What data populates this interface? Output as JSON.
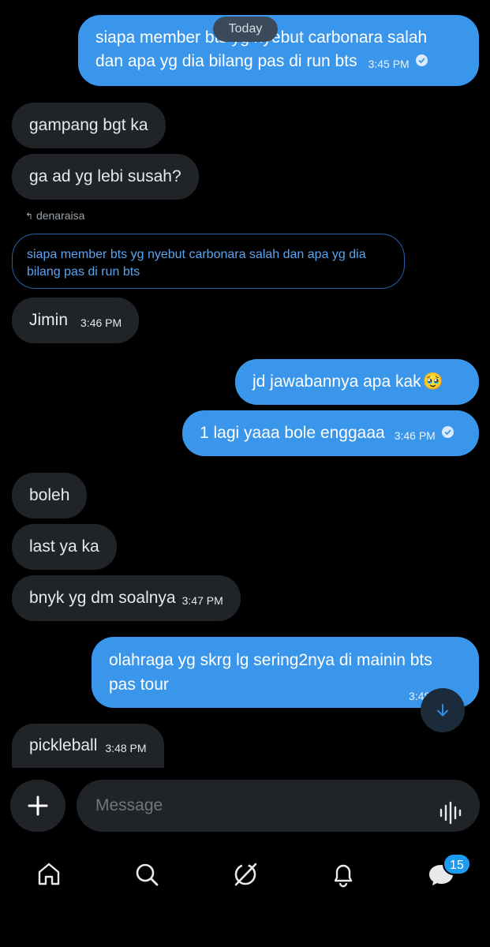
{
  "date_divider": "Today",
  "messages": [
    {
      "id": "m1",
      "side": "out",
      "text_line1": "siapa member bts yg nyebut carbonara salah",
      "text_line2": "dan apa yg dia bilang pas di run bts",
      "time": "3:45 PM"
    },
    {
      "id": "m2",
      "side": "in",
      "text": "gampang bgt ka"
    },
    {
      "id": "m3",
      "side": "in",
      "text": "ga ad yg lebi susah?"
    },
    {
      "id": "m4",
      "side": "in",
      "text": "Jimin",
      "time": "3:46 PM"
    },
    {
      "id": "m5",
      "side": "out",
      "text": "jd jawabannya apa kak",
      "emoji": "🥹"
    },
    {
      "id": "m6",
      "side": "out",
      "text": "1 lagi yaaa bole enggaaa",
      "time": "3:46 PM"
    },
    {
      "id": "m7",
      "side": "in",
      "text": "boleh"
    },
    {
      "id": "m8",
      "side": "in",
      "text": "last ya ka"
    },
    {
      "id": "m9",
      "side": "in",
      "text": "bnyk yg dm soalnya",
      "time": "3:47 PM"
    },
    {
      "id": "m10",
      "side": "out",
      "text_line1": "olahraga yg skrg lg sering2nya di mainin bts",
      "text_line2": "pas tour",
      "time": "3:48 PM"
    },
    {
      "id": "m11",
      "side": "in",
      "text": "pickleball",
      "time": "3:48 PM"
    }
  ],
  "reply": {
    "label": "denaraisa",
    "quote": "siapa member bts yg nyebut carbonara salah dan apa yg dia bilang pas di run bts"
  },
  "composer": {
    "placeholder": "Message"
  },
  "tabs": [
    "home-icon",
    "search-icon",
    "grok-icon",
    "notifications-icon",
    "messages-icon"
  ],
  "messages_badge": "15",
  "colors": {
    "outgoing": "#3a96ea",
    "incoming": "#202327",
    "accent": "#1d9bf0",
    "background": "#000000"
  }
}
